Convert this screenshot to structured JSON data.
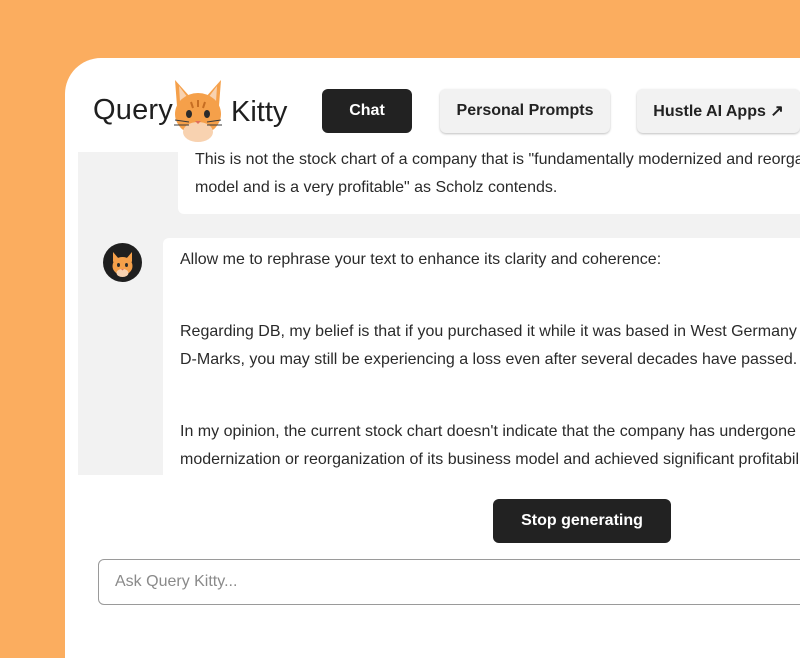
{
  "header": {
    "logo_left": "Query",
    "logo_right": "Kitty",
    "nav": {
      "chat": "Chat",
      "personal_prompts": "Personal Prompts",
      "hustle_apps": "Hustle AI Apps ↗"
    }
  },
  "messages": {
    "user": {
      "line1": "This is not the stock chart of a company that is \"fundamentally modernized and reorganized its business",
      "line2": "model and is a very profitable\" as Scholz contends."
    },
    "ai": {
      "p1": "Allow me to rephrase your text to enhance its clarity and coherence:",
      "p2_line1": "Regarding DB, my belief is that if you purchased it while it was based in West Germany and paid in",
      "p2_line2": "D-Marks, you may still be experiencing a loss even after several decades have passed.",
      "p3_line1": "In my opinion, the current stock chart doesn't indicate that the company has undergone a fundamental",
      "p3_line2": "modernization or reorganization of its business model and achieved significant profitability."
    }
  },
  "controls": {
    "stop_label": "Stop generating",
    "input_placeholder": "Ask Query Kitty..."
  },
  "colors": {
    "background": "#fbad5f",
    "panel": "#ffffff",
    "chat_bg": "#f2f2f2",
    "dark_button": "#222222",
    "cat": "#f5a04a"
  }
}
